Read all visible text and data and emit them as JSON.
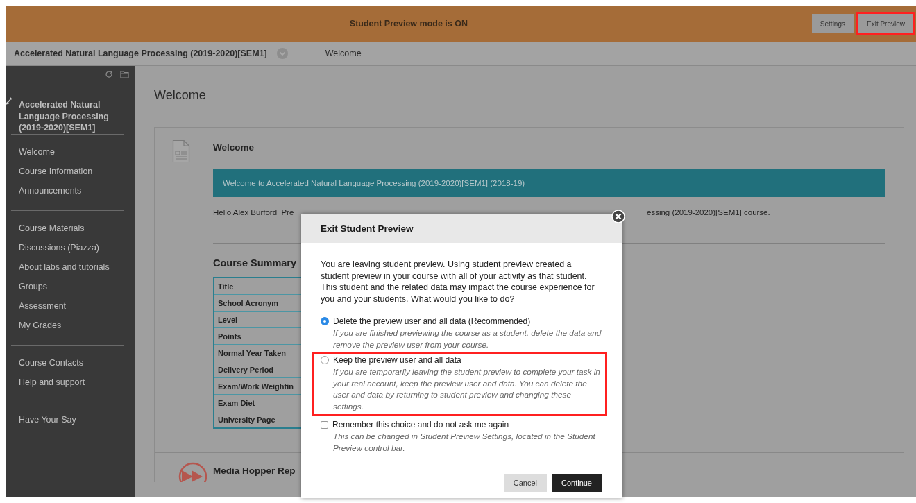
{
  "banner": {
    "message": "Student Preview mode is ON",
    "buttons": [
      {
        "label": "Settings",
        "highlighted": false
      },
      {
        "label": "Exit Preview",
        "highlighted": true
      }
    ]
  },
  "breadcrumb": {
    "course": "Accelerated Natural Language Processing (2019-2020)[SEM1]",
    "page": "Welcome"
  },
  "sidebar": {
    "course_title": "Accelerated Natural Language Processing (2019-2020)[SEM1]",
    "groups": [
      {
        "items": [
          "Welcome",
          "Course Information",
          "Announcements"
        ]
      },
      {
        "items": [
          "Course Materials",
          "Discussions (Piazza)",
          "About labs and tutorials",
          "Groups",
          "Assessment",
          "My Grades"
        ]
      },
      {
        "items": [
          "Course Contacts",
          "Help and support"
        ]
      },
      {
        "items": [
          "Have Your Say"
        ]
      }
    ]
  },
  "page_title": "Welcome",
  "content_item": {
    "title": "Welcome",
    "banner": "Welcome to Accelerated Natural Language Processing (2019-2020)[SEM1] (2018-19)",
    "greeting_start": "Hello Alex Burford_Pre",
    "greeting_end": "essing (2019-2020)[SEM1] course.",
    "summary_title": "Course Summary",
    "summary_rows": [
      "Title",
      "School Acronym",
      "Level",
      "Points",
      "Normal Year Taken",
      "Delivery Period",
      "Exam/Work Weightin",
      "Exam Diet",
      "University Page"
    ]
  },
  "next_item": {
    "title": "Media Hopper Rep"
  },
  "dialog": {
    "title": "Exit Student Preview",
    "message": "You are leaving student preview. Using student preview created a student preview in your course with all of your activity as that student. This student and the related data may impact the course experience for you and your students. What would you like to do?",
    "options": [
      {
        "label": "Delete the preview user and all data (Recommended)",
        "description": "If you are finished previewing the course as a student, delete the data and remove the preview user from your course.",
        "selected": true,
        "highlighted": false
      },
      {
        "label": "Keep the preview user and all data",
        "description": "If you are temporarily leaving the student preview to complete your task in your real account, keep the preview user and data. You can delete the user and data by returning to student preview and changing these settings.",
        "selected": false,
        "highlighted": true
      }
    ],
    "remember": {
      "label": "Remember this choice and do not ask me again",
      "description": "This can be changed in Student Preview Settings, located in the Student Preview control bar.",
      "checked": false
    },
    "buttons": [
      {
        "label": "Cancel",
        "kind": "secondary"
      },
      {
        "label": "Continue",
        "kind": "primary"
      }
    ]
  }
}
